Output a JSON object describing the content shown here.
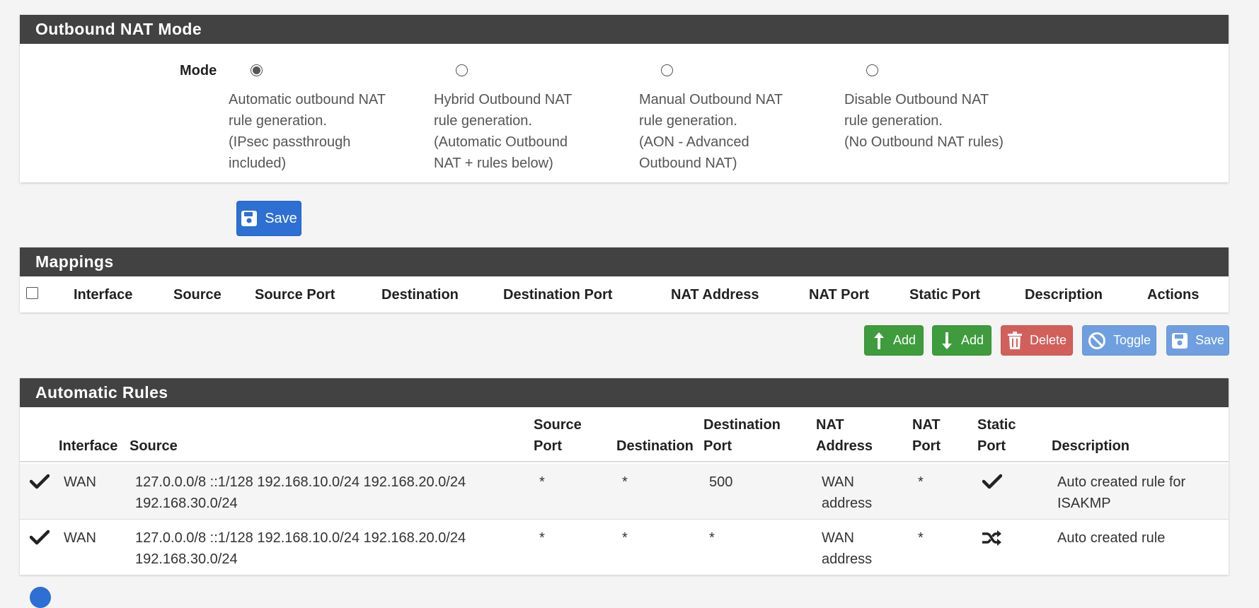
{
  "mode_panel": {
    "title": "Outbound NAT Mode",
    "mode_label": "Mode",
    "options": [
      {
        "lines": [
          "Automatic outbound NAT",
          "rule generation.",
          "(IPsec passthrough",
          "included)"
        ],
        "selected": true
      },
      {
        "lines": [
          "Hybrid Outbound NAT",
          "rule generation.",
          "(Automatic Outbound",
          "NAT + rules below)"
        ],
        "selected": false
      },
      {
        "lines": [
          "Manual Outbound NAT",
          "rule generation.",
          "(AON - Advanced",
          "Outbound NAT)"
        ],
        "selected": false
      },
      {
        "lines": [
          "Disable Outbound NAT",
          "rule generation.",
          "(No Outbound NAT rules)"
        ],
        "selected": false
      }
    ],
    "save_label": "Save"
  },
  "mappings": {
    "title": "Mappings",
    "columns": [
      "Interface",
      "Source",
      "Source Port",
      "Destination",
      "Destination Port",
      "NAT Address",
      "NAT Port",
      "Static Port",
      "Description",
      "Actions"
    ]
  },
  "actions": {
    "add_top": "Add",
    "add_bottom": "Add",
    "delete": "Delete",
    "toggle": "Toggle",
    "save": "Save"
  },
  "auto_rules": {
    "title": "Automatic Rules",
    "columns": {
      "interface": "Interface",
      "source": "Source",
      "source_port": [
        "Source",
        "Port"
      ],
      "destination": "Destination",
      "destination_port": [
        "Destination",
        "Port"
      ],
      "nat_address": [
        "NAT",
        "Address"
      ],
      "nat_port": [
        "NAT",
        "Port"
      ],
      "static_port": [
        "Static",
        "Port"
      ],
      "description": "Description"
    },
    "rows": [
      {
        "enabled_icon": "check-icon",
        "interface": "WAN",
        "source": [
          "127.0.0.0/8 ::1/128 192.168.10.0/24 192.168.20.0/24",
          "192.168.30.0/24"
        ],
        "source_port": "*",
        "destination": "*",
        "destination_port": "500",
        "nat_address": [
          "WAN",
          "address"
        ],
        "nat_port": "*",
        "static_port_icon": "check-icon",
        "description": [
          "Auto created rule for",
          "ISAKMP"
        ]
      },
      {
        "enabled_icon": "check-icon",
        "interface": "WAN",
        "source": [
          "127.0.0.0/8 ::1/128 192.168.10.0/24 192.168.20.0/24",
          "192.168.30.0/24"
        ],
        "source_port": "*",
        "destination": "*",
        "destination_port": "*",
        "nat_address": [
          "WAN",
          "address"
        ],
        "nat_port": "*",
        "static_port_icon": "shuffle-icon",
        "description": [
          "Auto created rule"
        ]
      }
    ]
  },
  "colors": {
    "panel_heading": "#424242",
    "primary": "#2d6fd2",
    "success": "#3e9c3c",
    "danger": "#d35f5b",
    "info_light": "#6f9fe0"
  }
}
